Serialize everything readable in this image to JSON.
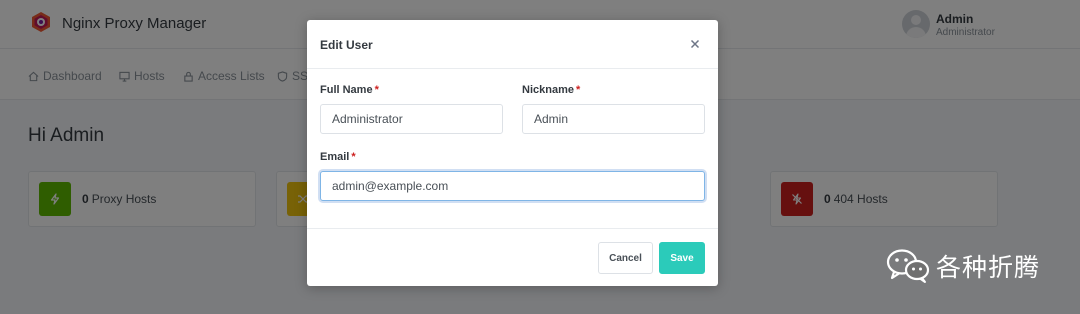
{
  "app": {
    "title": "Nginx Proxy Manager"
  },
  "user": {
    "name": "Admin",
    "role": "Administrator"
  },
  "nav": {
    "items": [
      {
        "label": "Dashboard",
        "icon": "home-icon"
      },
      {
        "label": "Hosts",
        "icon": "monitor-icon"
      },
      {
        "label": "Access Lists",
        "icon": "lock-icon"
      },
      {
        "label": "SSL",
        "icon": "shield-icon"
      }
    ]
  },
  "dashboard": {
    "greeting": "Hi Admin",
    "cards": [
      {
        "count": "0",
        "label": "Proxy Hosts",
        "color": "#5eba00",
        "icon": "zap-icon"
      },
      {
        "count": "",
        "label": "",
        "color": "#f1c40f",
        "icon": "shuffle-icon"
      },
      {
        "count": "0",
        "label": "404 Hosts",
        "color": "#cd201f",
        "icon": "zap-off-icon"
      }
    ]
  },
  "modal": {
    "title": "Edit User",
    "required_mark": "*",
    "full_name": {
      "label": "Full Name",
      "value": "Administrator"
    },
    "nickname": {
      "label": "Nickname",
      "value": "Admin"
    },
    "email": {
      "label": "Email",
      "value": "admin@example.com"
    },
    "cancel_label": "Cancel",
    "save_label": "Save"
  },
  "watermark": {
    "text": "各种折腾"
  },
  "colors": {
    "accent": "#2bcbba",
    "required": "#cd201f",
    "focus": "#7fb5e6"
  }
}
